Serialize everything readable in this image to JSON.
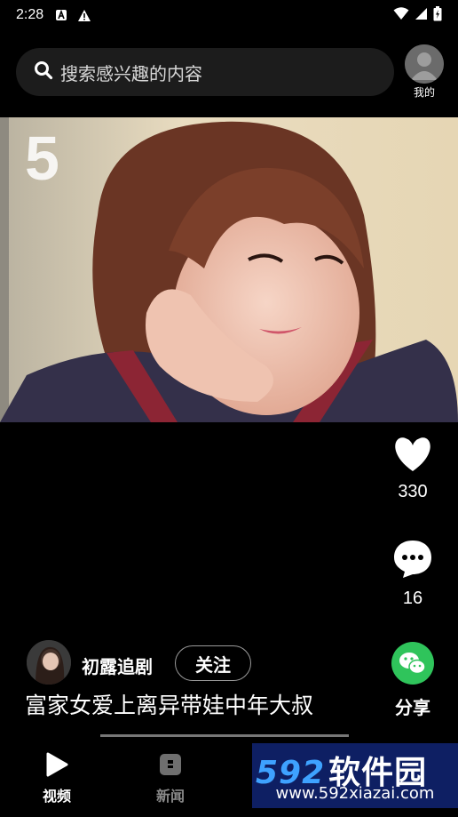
{
  "status_bar": {
    "time": "2:28"
  },
  "search": {
    "placeholder": "搜索感兴趣的内容"
  },
  "profile": {
    "label": "我的"
  },
  "video": {
    "overlay_number": "5"
  },
  "actions": {
    "like_count": "330",
    "comment_count": "16",
    "share_label": "分享"
  },
  "author": {
    "name": "初露追剧",
    "follow_label": "关注"
  },
  "caption": "富家女爱上离异带娃中年大叔",
  "progress": {
    "fraction": 0.35
  },
  "nav": {
    "video_label": "视频",
    "news_label": "新闻"
  },
  "watermark": {
    "brand_num": "592",
    "brand_text": "软件园",
    "url": "www.592xiazai.com"
  },
  "colors": {
    "accent_green": "#2fc45b",
    "watermark_bg": "#0e1f63",
    "watermark_blue": "#3ea2ff"
  }
}
